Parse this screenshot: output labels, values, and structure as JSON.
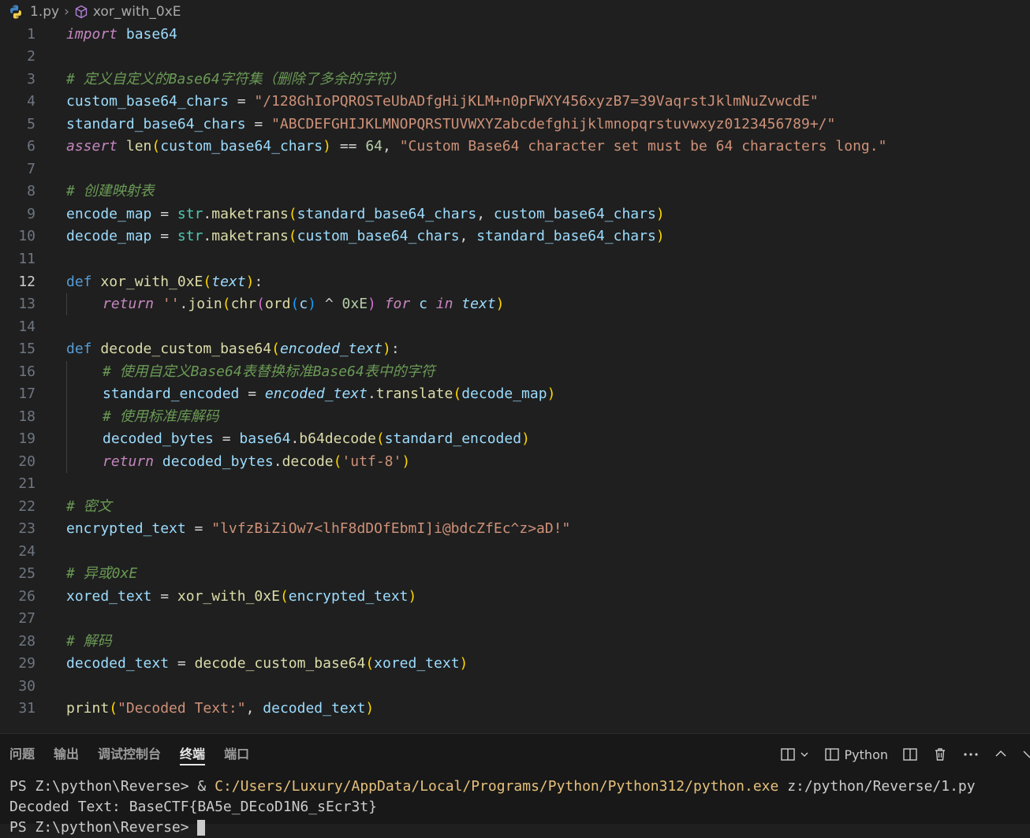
{
  "breadcrumb": {
    "file": "1.py",
    "symbol": "xor_with_0xE"
  },
  "line_numbers": [
    "1",
    "2",
    "3",
    "4",
    "5",
    "6",
    "7",
    "8",
    "9",
    "10",
    "11",
    "12",
    "13",
    "14",
    "15",
    "16",
    "17",
    "18",
    "19",
    "20",
    "21",
    "22",
    "23",
    "24",
    "25",
    "26",
    "27",
    "28",
    "29",
    "30",
    "31"
  ],
  "code": {
    "l1_kw": "import",
    "l1_mod": " base64",
    "l3_cmt": "# 定义自定义的Base64字符集（删除了多余的字符）",
    "l4_var": "custom_base64_chars",
    "l4_op": " = ",
    "l4_str": "\"/128GhIoPQROSTeUbADfgHijKLM+n0pFWXY456xyzB7=39VaqrstJklmNuZvwcdE\"",
    "l5_var": "standard_base64_chars",
    "l5_op": " = ",
    "l5_str": "\"ABCDEFGHIJKLMNOPQRSTUVWXYZabcdefghijklmnopqrstuvwxyz0123456789+/\"",
    "l6_kw": "assert",
    "l6_fn": " len",
    "l6_p": "(",
    "l6_var": "custom_base64_chars",
    "l6_pc": ")",
    "l6_op": " == ",
    "l6_num": "64",
    "l6_comma": ", ",
    "l6_str": "\"Custom Base64 character set must be 64 characters long.\"",
    "l8_cmt": "# 创建映射表",
    "l9_var": "encode_map",
    "l9_op": " = ",
    "l9_cls": "str",
    "l9_dot": ".",
    "l9_fn": "maketrans",
    "l9_p": "(",
    "l9_a1": "standard_base64_chars",
    "l9_c": ", ",
    "l9_a2": "custom_base64_chars",
    "l9_pc": ")",
    "l10_var": "decode_map",
    "l10_op": " = ",
    "l10_cls": "str",
    "l10_dot": ".",
    "l10_fn": "maketrans",
    "l10_p": "(",
    "l10_a1": "custom_base64_chars",
    "l10_c": ", ",
    "l10_a2": "standard_base64_chars",
    "l10_pc": ")",
    "l12_kw": "def",
    "l12_fn": " xor_with_0xE",
    "l12_p": "(",
    "l12_param": "text",
    "l12_pc": ")",
    "l12_colon": ":",
    "l13_kw": "return",
    "l13_str": " ''",
    "l13_dot": ".",
    "l13_fn": "join",
    "l13_p": "(",
    "l13_fn2": "chr",
    "l13_p2": "(",
    "l13_fn3": "ord",
    "l13_p3": "(",
    "l13_c": "c",
    "l13_p3c": ")",
    "l13_op": " ^ ",
    "l13_num": "0xE",
    "l13_p2c": ")",
    "l13_for": " for",
    "l13_c2": " c",
    "l13_in": " in",
    "l13_text": " text",
    "l13_pc": ")",
    "l15_kw": "def",
    "l15_fn": " decode_custom_base64",
    "l15_p": "(",
    "l15_param": "encoded_text",
    "l15_pc": ")",
    "l15_colon": ":",
    "l16_cmt": "# 使用自定义Base64表替换标准Base64表中的字符",
    "l17_var": "standard_encoded",
    "l17_op": " = ",
    "l17_param": "encoded_text",
    "l17_dot": ".",
    "l17_fn": "translate",
    "l17_p": "(",
    "l17_arg": "decode_map",
    "l17_pc": ")",
    "l18_cmt": "# 使用标准库解码",
    "l19_var": "decoded_bytes",
    "l19_op": " = ",
    "l19_mod": "base64",
    "l19_dot": ".",
    "l19_fn": "b64decode",
    "l19_p": "(",
    "l19_arg": "standard_encoded",
    "l19_pc": ")",
    "l20_kw": "return",
    "l20_var": " decoded_bytes",
    "l20_dot": ".",
    "l20_fn": "decode",
    "l20_p": "(",
    "l20_str": "'utf-8'",
    "l20_pc": ")",
    "l22_cmt": "# 密文",
    "l23_var": "encrypted_text",
    "l23_op": " = ",
    "l23_str": "\"lvfzBiZiOw7<lhF8dDOfEbmI]i@bdcZfEc^z>aD!\"",
    "l25_cmt": "# 异或0xE",
    "l26_var": "xored_text",
    "l26_op": " = ",
    "l26_fn": "xor_with_0xE",
    "l26_p": "(",
    "l26_arg": "encrypted_text",
    "l26_pc": ")",
    "l28_cmt": "# 解码",
    "l29_var": "decoded_text",
    "l29_op": " = ",
    "l29_fn": "decode_custom_base64",
    "l29_p": "(",
    "l29_arg": "xored_text",
    "l29_pc": ")",
    "l31_fn": "print",
    "l31_p": "(",
    "l31_str": "\"Decoded Text:\"",
    "l31_c": ", ",
    "l31_arg": "decoded_text",
    "l31_pc": ")"
  },
  "panel": {
    "tabs": [
      "问题",
      "输出",
      "调试控制台",
      "终端",
      "端口"
    ],
    "active_tab": "终端",
    "shell_label": "Python"
  },
  "terminal": {
    "prompt1": "PS Z:\\python\\Reverse> ",
    "cmd_amp": "& ",
    "cmd_exe": "C:/Users/Luxury/AppData/Local/Programs/Python/Python312/python.exe",
    "cmd_arg": " z:/python/Reverse/1.py",
    "output": "Decoded Text: BaseCTF{BA5e_DEcoD1N6_sEcr3t}",
    "prompt2": "PS Z:\\python\\Reverse> "
  }
}
